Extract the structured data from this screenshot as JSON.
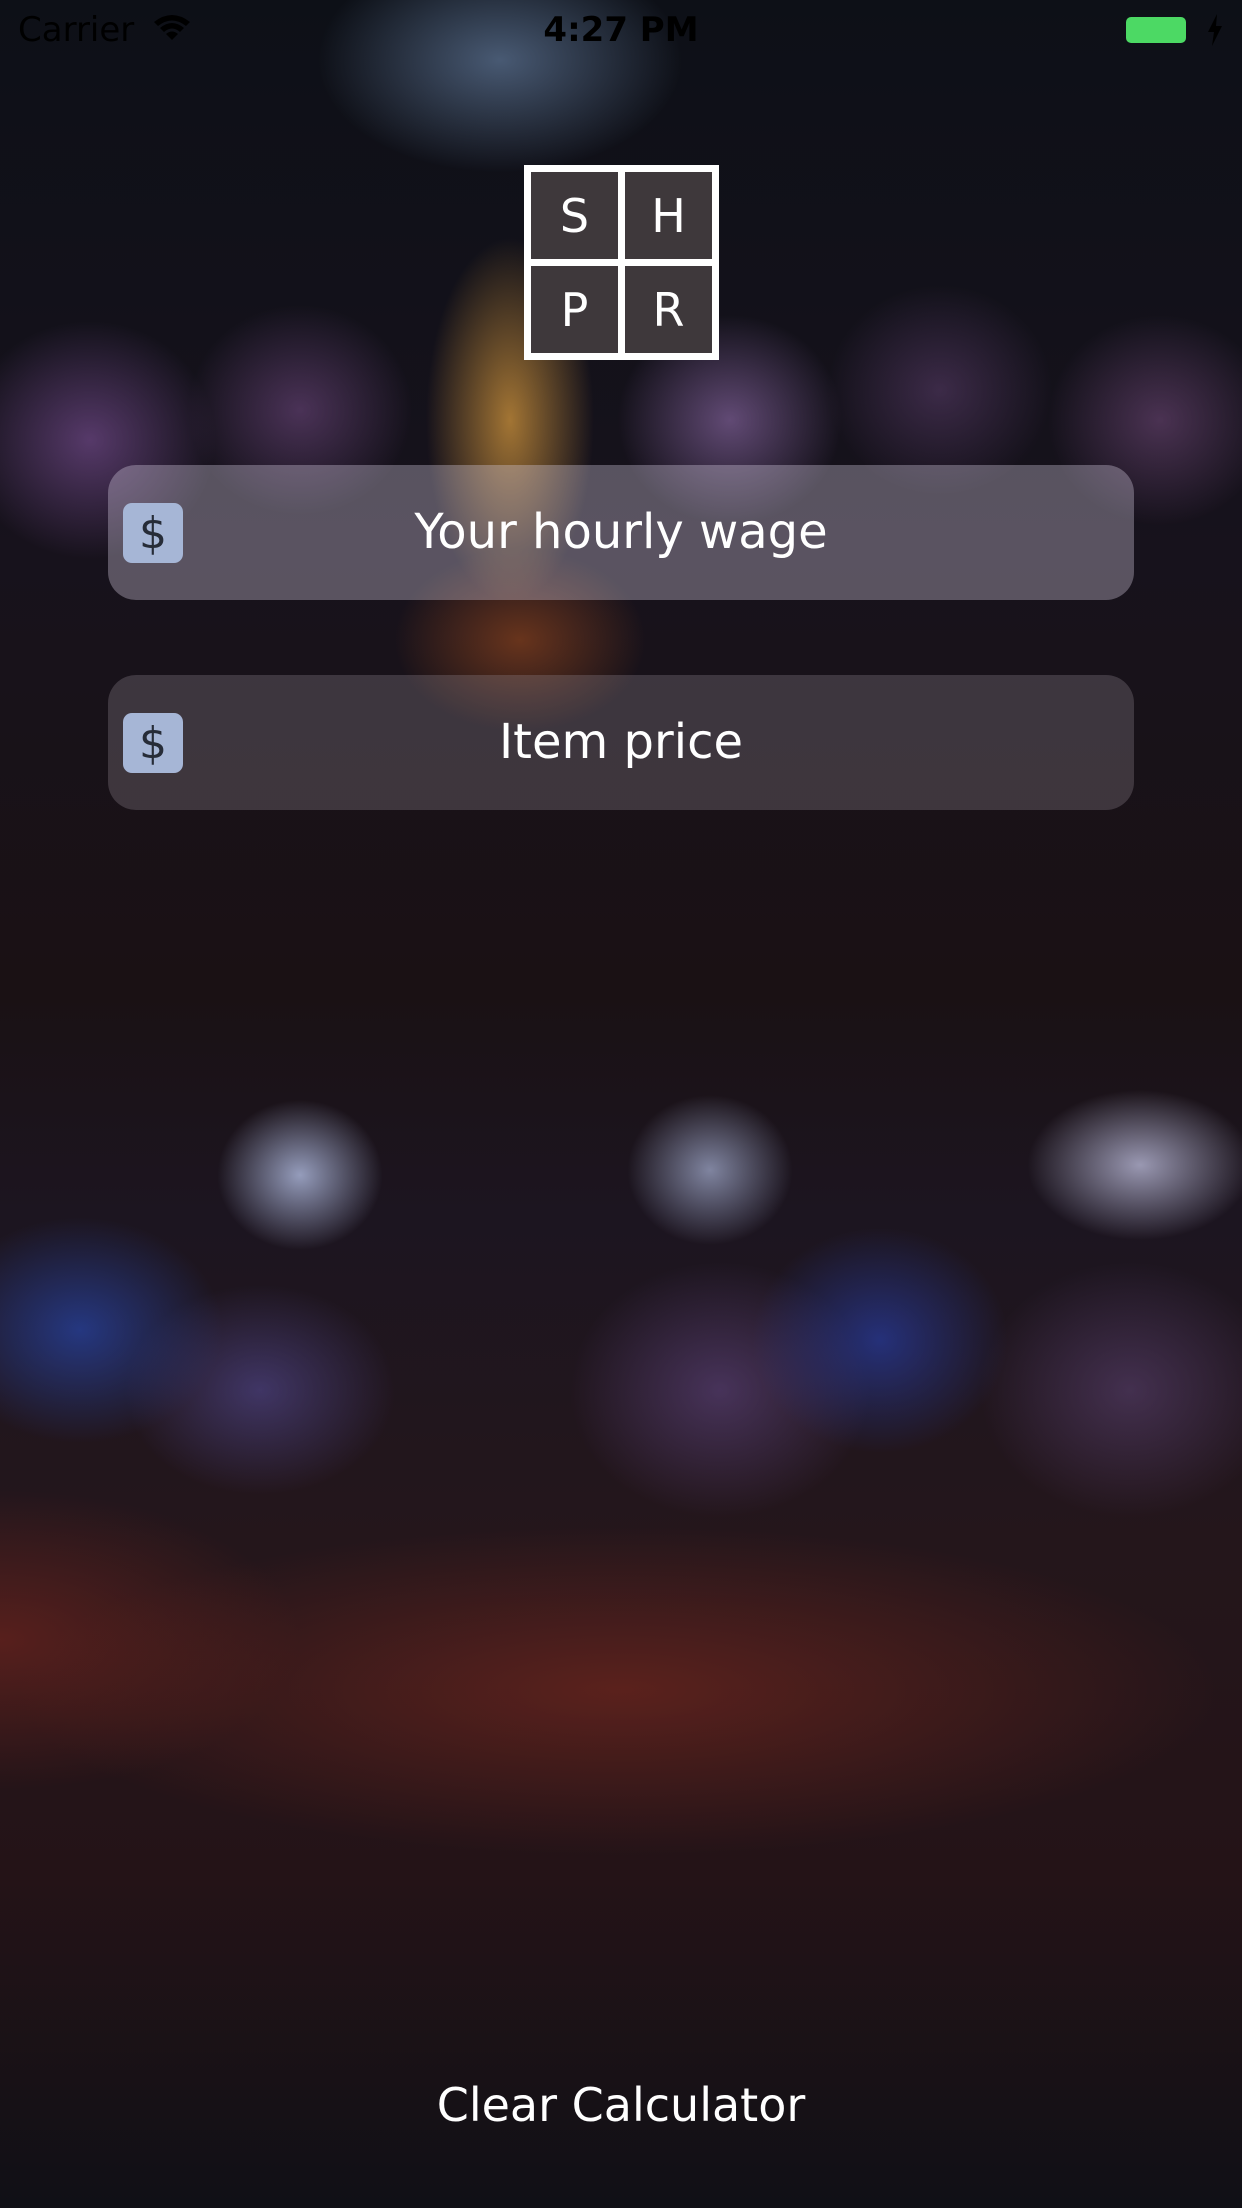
{
  "status_bar": {
    "carrier": "Carrier",
    "time": "4:27 PM",
    "battery_color": "#4cd964",
    "icons": [
      "wifi-icon",
      "battery-icon",
      "charging-bolt-icon"
    ]
  },
  "logo": {
    "letters": [
      "S",
      "H",
      "P",
      "R"
    ]
  },
  "fields": [
    {
      "icon_symbol": "$",
      "placeholder": "Your hourly wage"
    },
    {
      "icon_symbol": "$",
      "placeholder": "Item price"
    }
  ],
  "actions": {
    "clear_label": "Clear Calculator"
  },
  "colors": {
    "field_icon_bg": "#a6b6d6",
    "text": "#ffffff"
  }
}
